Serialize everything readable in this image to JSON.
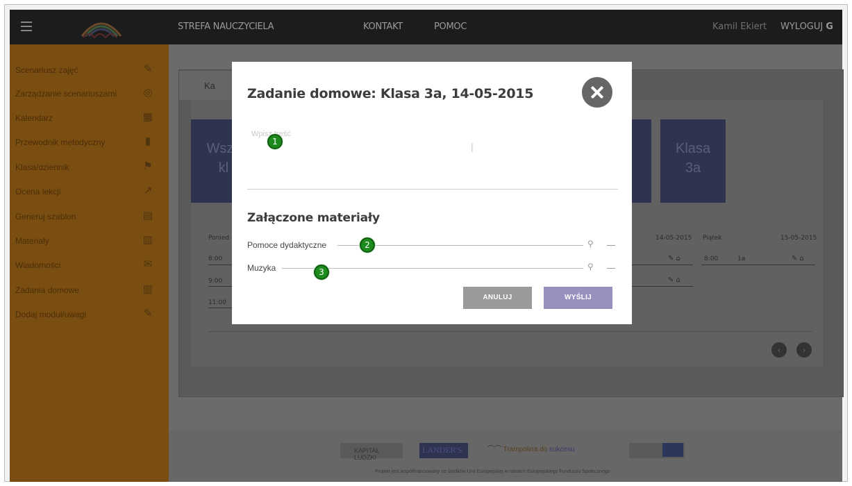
{
  "topbar": {
    "nav": [
      "STREFA NAUCZYCIELA",
      "KONTAKT",
      "POMOC"
    ],
    "user_name": "Kamil Ekiert",
    "logout_label": "WYLOGUJ"
  },
  "sidebar": {
    "items": [
      {
        "label": "Scenariusz zajęć",
        "icon": "edit-icon"
      },
      {
        "label": "Zarządzanie scenariuszami",
        "icon": "compass-icon"
      },
      {
        "label": "Kalendarz",
        "icon": "calendar-icon"
      },
      {
        "label": "Przewodnik metodyczny",
        "icon": "book-icon"
      },
      {
        "label": "Klasa/dziennik",
        "icon": "flag-icon"
      },
      {
        "label": "Ocena lekcji",
        "icon": "chart-icon"
      },
      {
        "label": "Generuj szablon",
        "icon": "document-icon"
      },
      {
        "label": "Materiały",
        "icon": "film-icon"
      },
      {
        "label": "Wiadomości",
        "icon": "envelope-icon"
      },
      {
        "label": "Zadania domowe",
        "icon": "books-icon"
      },
      {
        "label": "Dodaj moduł/uwagi",
        "icon": "note-icon"
      }
    ]
  },
  "background": {
    "tab_label": "Ka",
    "tile_left_line1": "Wszy",
    "tile_left_line2": "kl",
    "tile_right_line1": "Klasa",
    "tile_right_line2": "3a",
    "schedule": {
      "day_left": "Ponied",
      "date_thu": "14-05-2015",
      "day_fri": "Piątek",
      "date_fri": "15-05-2015",
      "times": [
        "8:00",
        "9:00",
        "11:00"
      ],
      "fri_time": "8:00",
      "fri_class": "1a"
    }
  },
  "modal": {
    "title": "Zadanie domowe: Klasa 3a, 14-05-2015",
    "textarea_placeholder": "Wpisz treść",
    "section_title": "Załączone materiały",
    "materials": [
      "Pomoce dydaktyczne",
      "Muzyka"
    ],
    "cancel_label": "ANULUJ",
    "send_label": "WYŚLIJ"
  },
  "markers": [
    "1",
    "2",
    "3"
  ],
  "footer": {
    "logo_1": "KAPITAŁ LUDZKI",
    "logo_2": "LANDER'S",
    "logo_3_a": "Trampolina do",
    "logo_3_b": "sukcesu",
    "note": "Projekt jest współfinansowany ze środków Unii Europejskiej w ramach Europejskiego Funduszu Społecznego"
  },
  "colors": {
    "topbar": "#1c1c1c",
    "sidebar": "#7a4d10",
    "send_button": "#9990bf",
    "cancel_button": "#9a9a9a",
    "marker": "#1d8a1d"
  }
}
